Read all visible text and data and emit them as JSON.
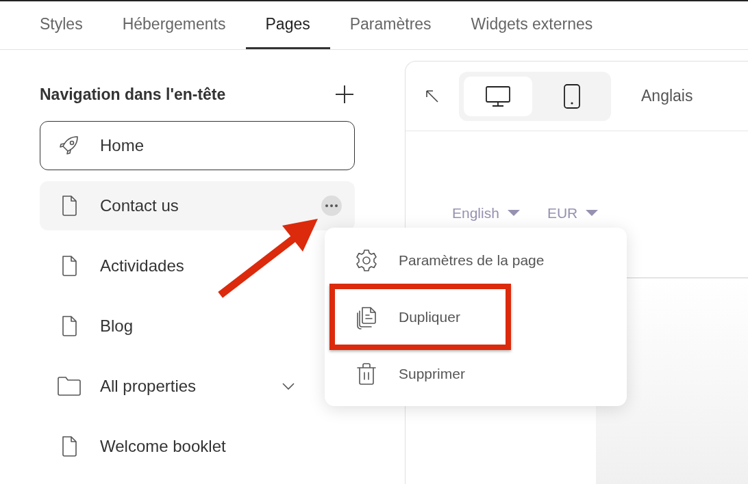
{
  "tabs": [
    {
      "label": "Styles",
      "selected": false
    },
    {
      "label": "Hébergements",
      "selected": false
    },
    {
      "label": "Pages",
      "selected": true
    },
    {
      "label": "Paramètres",
      "selected": false
    },
    {
      "label": "Widgets externes",
      "selected": false
    }
  ],
  "navigation": {
    "title": "Navigation dans l'en-tête",
    "items": [
      {
        "label": "Home",
        "kind": "home",
        "selected": true,
        "highlighted": false
      },
      {
        "label": "Contact us",
        "kind": "page",
        "selected": false,
        "highlighted": true
      },
      {
        "label": "Actividades",
        "kind": "page",
        "selected": false,
        "highlighted": false
      },
      {
        "label": "Blog",
        "kind": "page",
        "selected": false,
        "highlighted": false
      },
      {
        "label": "All properties",
        "kind": "folder",
        "selected": false,
        "highlighted": false,
        "expanded": false
      },
      {
        "label": "Welcome booklet",
        "kind": "page",
        "selected": false,
        "highlighted": false
      }
    ]
  },
  "preview": {
    "devices": [
      {
        "kind": "desktop",
        "selected": true
      },
      {
        "kind": "mobile",
        "selected": false
      }
    ],
    "language": "Anglais",
    "site_header": {
      "language": "English",
      "currency": "EUR"
    }
  },
  "context_menu": {
    "items": [
      {
        "label": "Paramètres de la page",
        "kind": "settings",
        "annotated": false
      },
      {
        "label": "Dupliquer",
        "kind": "duplicate",
        "annotated": true
      },
      {
        "label": "Supprimer",
        "kind": "delete",
        "annotated": false
      }
    ]
  }
}
